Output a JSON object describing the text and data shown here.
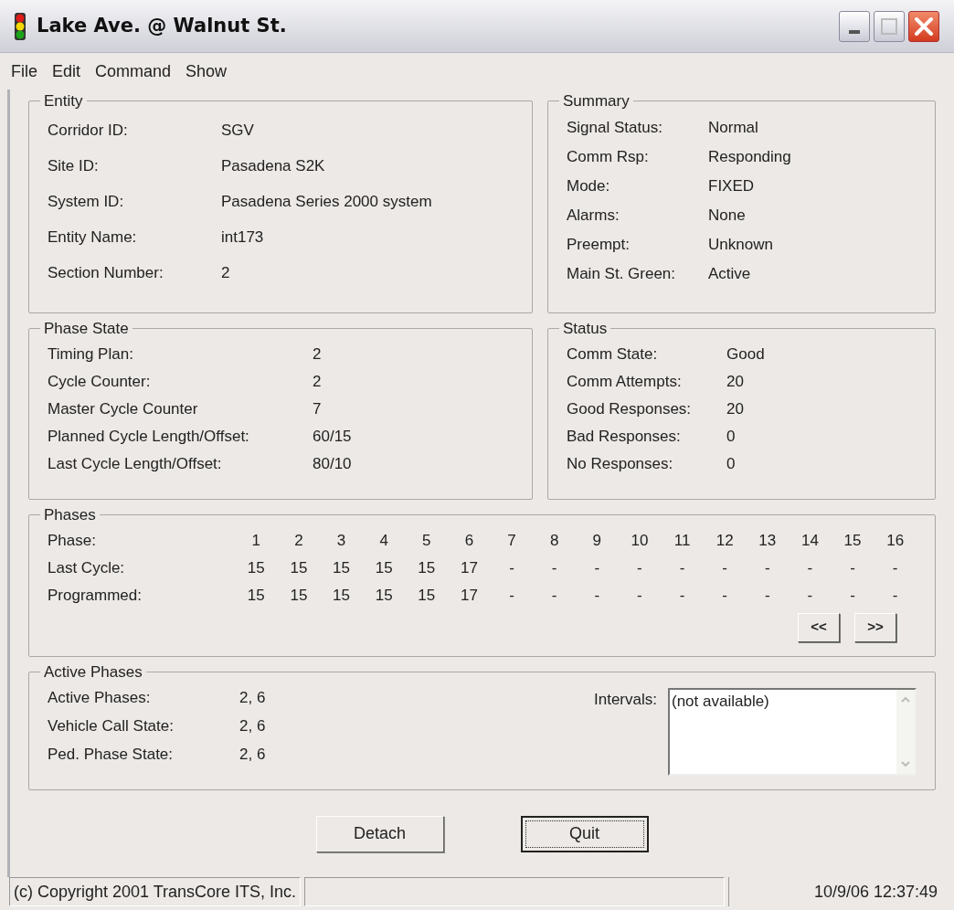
{
  "window": {
    "title": "Lake Ave. @ Walnut St."
  },
  "menu": [
    "File",
    "Edit",
    "Command",
    "Show"
  ],
  "entity": {
    "title": "Entity",
    "fields": [
      {
        "label": "Corridor ID:",
        "value": "SGV"
      },
      {
        "label": "Site ID:",
        "value": "Pasadena S2K"
      },
      {
        "label": "System ID:",
        "value": "Pasadena Series 2000 system"
      },
      {
        "label": "Entity Name:",
        "value": "int173"
      },
      {
        "label": "Section Number:",
        "value": "2"
      }
    ]
  },
  "summary": {
    "title": "Summary",
    "fields": [
      {
        "label": "Signal Status:",
        "value": "Normal"
      },
      {
        "label": "Comm Rsp:",
        "value": "Responding"
      },
      {
        "label": "Mode:",
        "value": "FIXED"
      },
      {
        "label": "Alarms:",
        "value": "None"
      },
      {
        "label": "Preempt:",
        "value": "Unknown"
      },
      {
        "label": "Main St. Green:",
        "value": "Active"
      }
    ]
  },
  "phase_state": {
    "title": "Phase State",
    "fields": [
      {
        "label": "Timing Plan:",
        "value": "2"
      },
      {
        "label": "Cycle Counter:",
        "value": "2"
      },
      {
        "label": "Master Cycle Counter",
        "value": "7"
      },
      {
        "label": "Planned Cycle Length/Offset:",
        "value": "60/15"
      },
      {
        "label": "Last Cycle Length/Offset:",
        "value": "80/10"
      }
    ]
  },
  "status": {
    "title": "Status",
    "fields": [
      {
        "label": "Comm State:",
        "value": "Good"
      },
      {
        "label": "Comm Attempts:",
        "value": "20"
      },
      {
        "label": "Good Responses:",
        "value": "20"
      },
      {
        "label": "Bad Responses:",
        "value": "0"
      },
      {
        "label": "No Responses:",
        "value": "0"
      }
    ]
  },
  "phases": {
    "title": "Phases",
    "rows": [
      {
        "label": "Phase:",
        "cells": [
          "1",
          "2",
          "3",
          "4",
          "5",
          "6",
          "7",
          "8",
          "9",
          "10",
          "11",
          "12",
          "13",
          "14",
          "15",
          "16"
        ]
      },
      {
        "label": "Last Cycle:",
        "cells": [
          "15",
          "15",
          "15",
          "15",
          "15",
          "17",
          "-",
          "-",
          "-",
          "-",
          "-",
          "-",
          "-",
          "-",
          "-",
          "-"
        ]
      },
      {
        "label": "Programmed:",
        "cells": [
          "15",
          "15",
          "15",
          "15",
          "15",
          "17",
          "-",
          "-",
          "-",
          "-",
          "-",
          "-",
          "-",
          "-",
          "-",
          "-"
        ]
      }
    ],
    "buttons": [
      "<<",
      ">>"
    ]
  },
  "active_phases": {
    "title": "Active Phases",
    "fields": [
      {
        "label": "Active Phases:",
        "value": "2, 6"
      },
      {
        "label": "Vehicle Call State:",
        "value": "2, 6"
      },
      {
        "label": "Ped. Phase State:",
        "value": "2, 6"
      }
    ],
    "intervals_label": "Intervals:",
    "intervals_value": "(not available)"
  },
  "buttons": [
    {
      "label": "Detach",
      "focused": false
    },
    {
      "label": "Quit",
      "focused": true
    }
  ],
  "status_bar": {
    "copyright": "(c) Copyright 2001 TransCore ITS, Inc.",
    "datetime": "10/9/06 12:37:49"
  }
}
